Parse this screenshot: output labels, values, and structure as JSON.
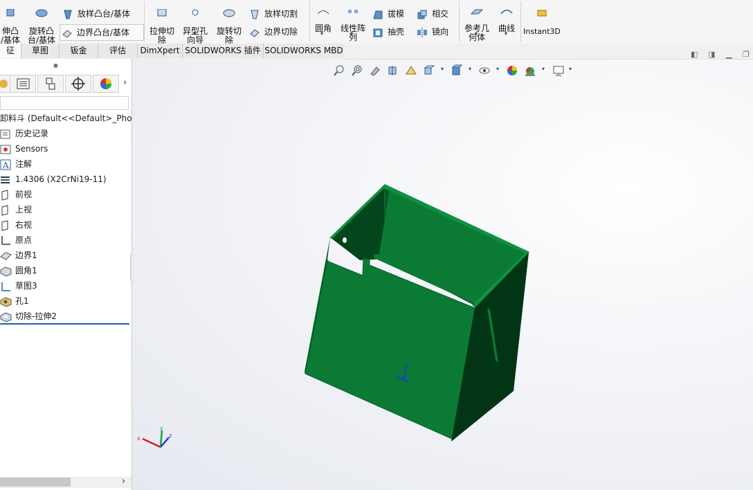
{
  "ribbon": {
    "extrude_boss": "伸凸\n/基体",
    "revolve_boss": "旋转凸\n台/基体",
    "lofted_boss": "放样凸台/基体",
    "boundary_boss": "边界凸台/基体",
    "extrude_cut": "拉伸切\n除",
    "hole_wizard": "异型孔\n向导",
    "revolve_cut": "旋转切\n除",
    "lofted_cut": "放样切割",
    "boundary_cut": "边界切除",
    "fillet": "圆角",
    "linear_pattern": "线性阵\n列",
    "draft": "拔模",
    "shell": "抽壳",
    "intersect": "相交",
    "mirror": "镜向",
    "ref_geometry": "参考几\n何体",
    "curves": "曲线",
    "instant3d": "Instant3D"
  },
  "tabs": [
    "征",
    "草图",
    "钣金",
    "评估",
    "DimXpert",
    "SOLIDWORKS 插件",
    "SOLIDWORKS MBD"
  ],
  "tree": {
    "root": "卸料斗  (Default<<Default>_Phot",
    "items": [
      {
        "label": "历史记录",
        "icon": "history-icon"
      },
      {
        "label": "Sensors",
        "icon": "sensors-icon"
      },
      {
        "label": "注解",
        "icon": "annotations-icon"
      },
      {
        "label": "1.4306 (X2CrNi19-11)",
        "icon": "material-icon"
      },
      {
        "label": "前视",
        "icon": "plane-icon"
      },
      {
        "label": "上视",
        "icon": "plane-icon"
      },
      {
        "label": "右视",
        "icon": "plane-icon"
      },
      {
        "label": "原点",
        "icon": "origin-icon"
      },
      {
        "label": "边界1",
        "icon": "boundary-feature-icon"
      },
      {
        "label": "圆角1",
        "icon": "fillet-feature-icon"
      },
      {
        "label": "草图3",
        "icon": "sketch-icon"
      },
      {
        "label": "孔1",
        "icon": "hole-feature-icon"
      },
      {
        "label": "切除-拉伸2",
        "icon": "cut-extrude-feature-icon"
      }
    ]
  },
  "colors": {
    "part": "#0b7a35",
    "part_dark": "#04461c",
    "tree_selection": "#1f5fa8"
  }
}
